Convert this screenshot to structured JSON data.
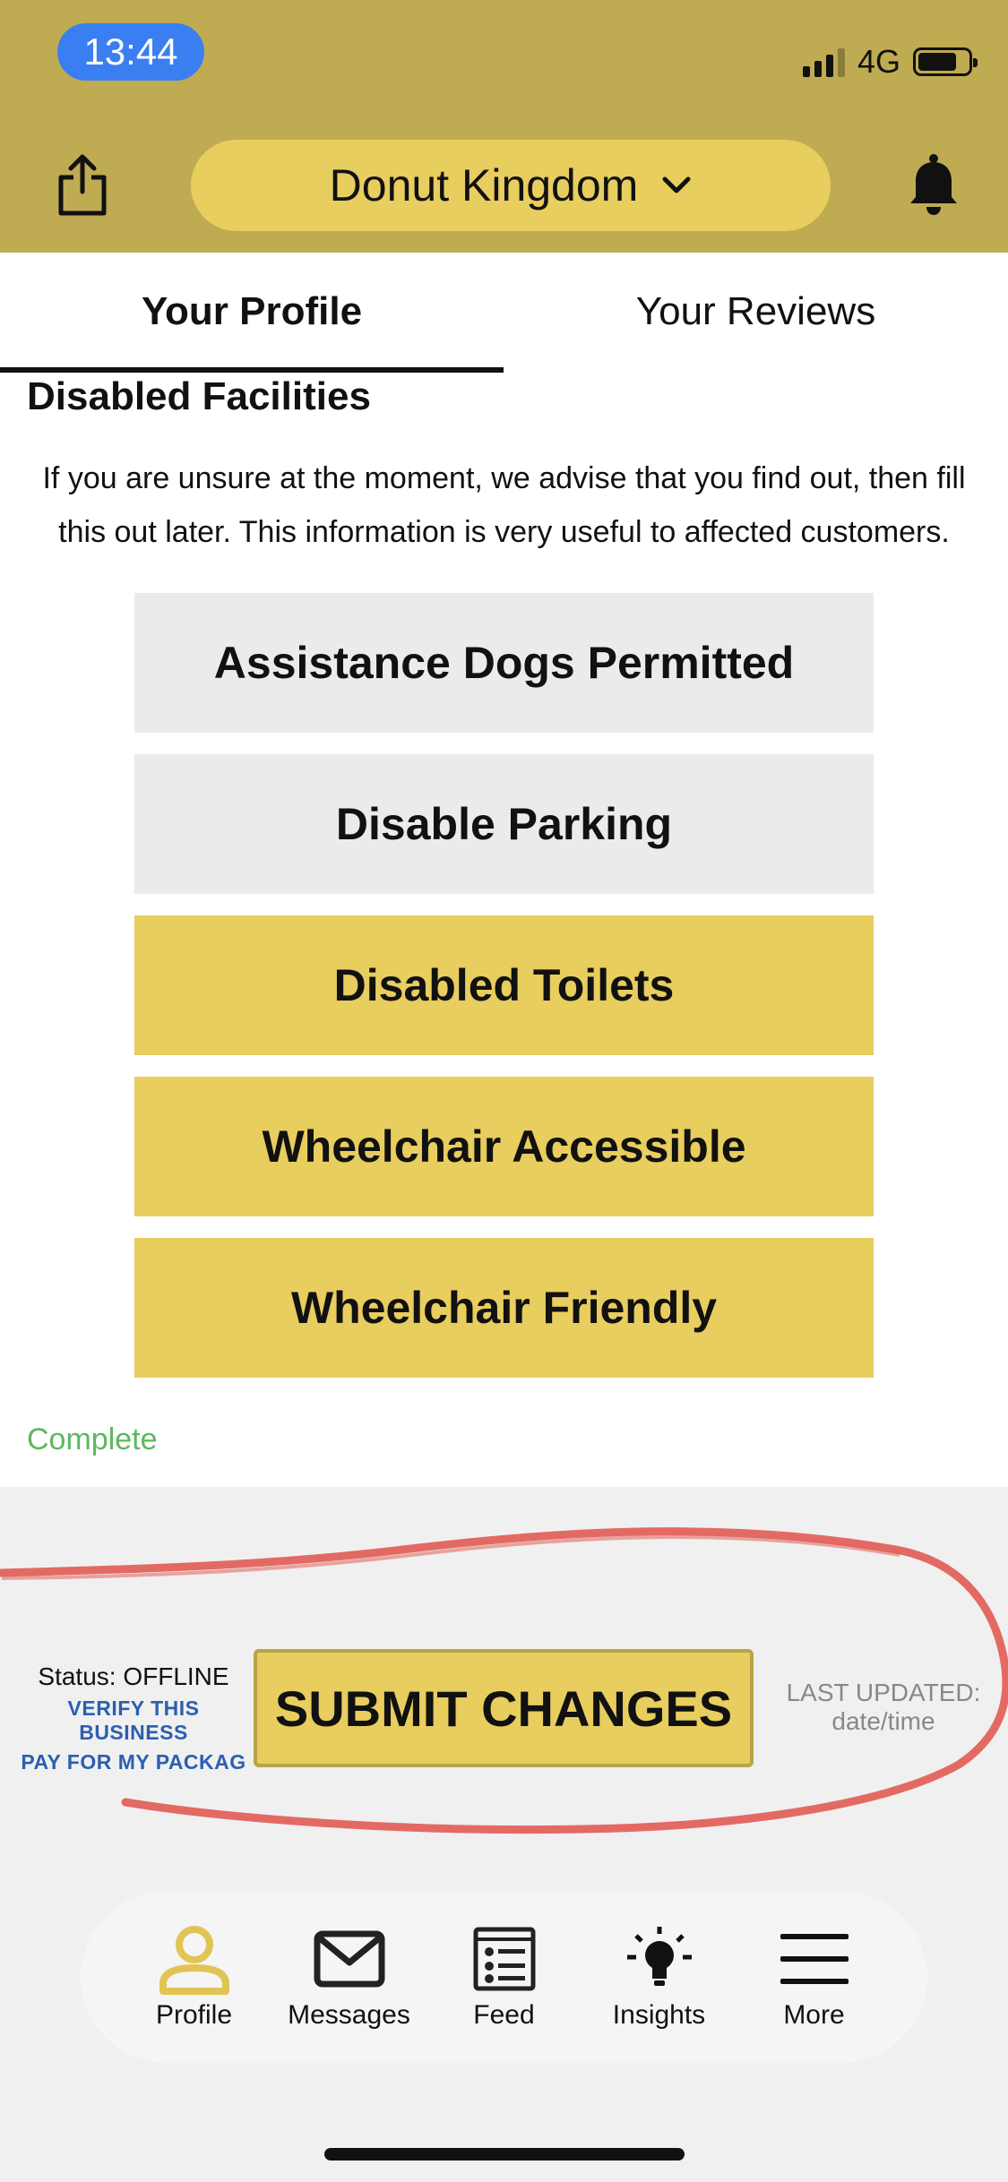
{
  "status_bar": {
    "time": "13:44",
    "network": "4G"
  },
  "header": {
    "business_name": "Donut Kingdom"
  },
  "tabs": [
    {
      "label": "Your Profile",
      "active": true
    },
    {
      "label": "Your Reviews",
      "active": false
    }
  ],
  "section": {
    "title": "Disabled Facilities",
    "description": "If you are unsure at the moment, we advise that you find out, then fill this out later. This information is very useful to affected customers."
  },
  "facilities": [
    {
      "label": "Assistance Dogs Permitted",
      "selected": false
    },
    {
      "label": "Disable Parking",
      "selected": false
    },
    {
      "label": "Disabled Toilets",
      "selected": true
    },
    {
      "label": "Wheelchair Accessible",
      "selected": true
    },
    {
      "label": "Wheelchair Friendly",
      "selected": true
    }
  ],
  "completion": {
    "text": "Complete"
  },
  "footer": {
    "status": "Status: OFFLINE",
    "verify_link": "VERIFY THIS BUSINESS",
    "pay_link": "PAY FOR MY PACKAG",
    "submit_label": "SUBMIT CHANGES",
    "last_updated_label": "LAST UPDATED:",
    "last_updated_value": "date/time"
  },
  "nav": [
    {
      "label": "Profile",
      "icon": "person-icon",
      "active": true
    },
    {
      "label": "Messages",
      "icon": "envelope-icon",
      "active": false
    },
    {
      "label": "Feed",
      "icon": "feed-icon",
      "active": false
    },
    {
      "label": "Insights",
      "icon": "lightbulb-icon",
      "active": false
    },
    {
      "label": "More",
      "icon": "menu-icon",
      "active": false
    }
  ],
  "colors": {
    "header_bg": "#bfab52",
    "accent_yellow": "#e8cd5f",
    "unselected_grey": "#ebebeb",
    "time_pill_blue": "#3a7ef2",
    "link_blue": "#2b5fb0",
    "complete_green": "#5cb85c",
    "annotation_red": "#e0524a"
  }
}
